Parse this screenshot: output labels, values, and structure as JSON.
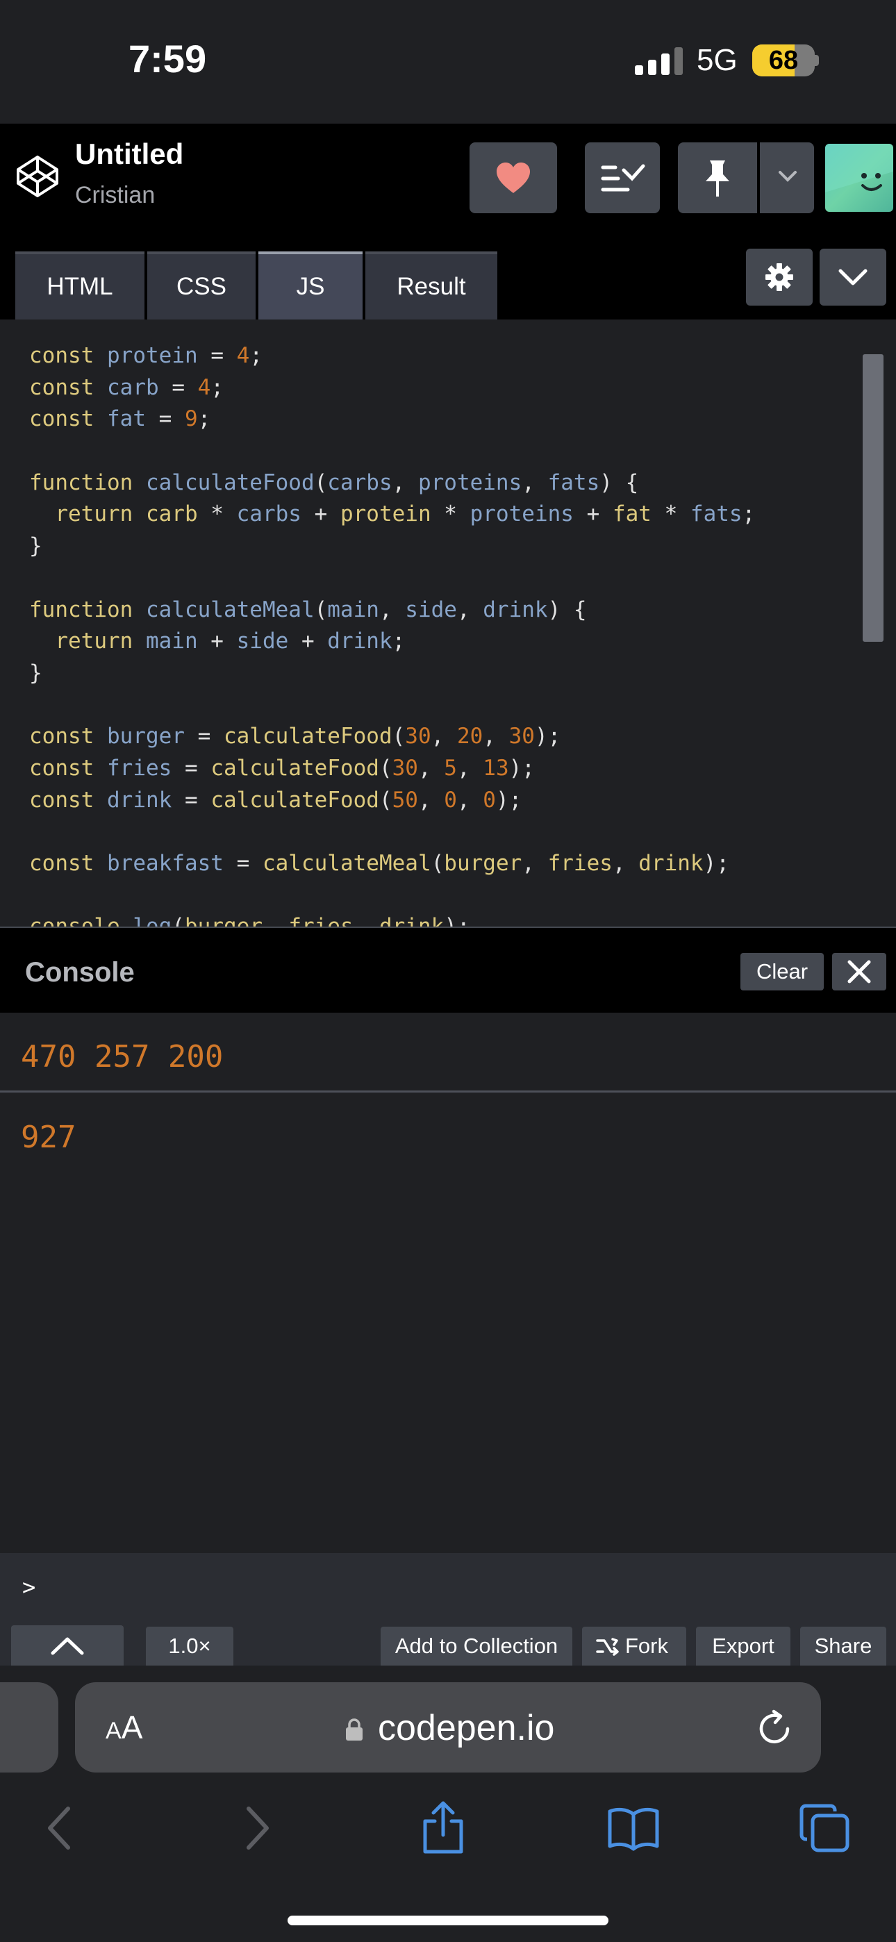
{
  "status": {
    "time": "7:59",
    "network": "5G",
    "battery": "68",
    "battery_level": 0.68
  },
  "header": {
    "title": "Untitled",
    "owner": "Cristian"
  },
  "tabs": [
    {
      "label": "HTML"
    },
    {
      "label": "CSS"
    },
    {
      "label": "JS",
      "active": true
    },
    {
      "label": "Result"
    }
  ],
  "code_lines": [
    [
      [
        "kw",
        "const"
      ],
      [
        "pu",
        " "
      ],
      [
        "vr",
        "protein"
      ],
      [
        "pu",
        " = "
      ],
      [
        "nm",
        "4"
      ],
      [
        "pu",
        ";"
      ]
    ],
    [
      [
        "kw",
        "const"
      ],
      [
        "pu",
        " "
      ],
      [
        "vr",
        "carb"
      ],
      [
        "pu",
        " = "
      ],
      [
        "nm",
        "4"
      ],
      [
        "pu",
        ";"
      ]
    ],
    [
      [
        "kw",
        "const"
      ],
      [
        "pu",
        " "
      ],
      [
        "vr",
        "fat"
      ],
      [
        "pu",
        " = "
      ],
      [
        "nm",
        "9"
      ],
      [
        "pu",
        ";"
      ]
    ],
    [],
    [
      [
        "kw",
        "function"
      ],
      [
        "pu",
        " "
      ],
      [
        "vr",
        "calculateFood"
      ],
      [
        "pu",
        "("
      ],
      [
        "vr",
        "carbs"
      ],
      [
        "pu",
        ", "
      ],
      [
        "vr",
        "proteins"
      ],
      [
        "pu",
        ", "
      ],
      [
        "vr",
        "fats"
      ],
      [
        "pu",
        ") {"
      ]
    ],
    [
      [
        "pu",
        "  "
      ],
      [
        "kw",
        "return"
      ],
      [
        "pu",
        " "
      ],
      [
        "kw",
        "carb"
      ],
      [
        "pu",
        " * "
      ],
      [
        "vr",
        "carbs"
      ],
      [
        "pu",
        " + "
      ],
      [
        "kw",
        "protein"
      ],
      [
        "pu",
        " * "
      ],
      [
        "vr",
        "proteins"
      ],
      [
        "pu",
        " + "
      ],
      [
        "kw",
        "fat"
      ],
      [
        "pu",
        " * "
      ],
      [
        "vr",
        "fats"
      ],
      [
        "pu",
        ";"
      ]
    ],
    [
      [
        "pu",
        "}"
      ]
    ],
    [],
    [
      [
        "kw",
        "function"
      ],
      [
        "pu",
        " "
      ],
      [
        "vr",
        "calculateMeal"
      ],
      [
        "pu",
        "("
      ],
      [
        "vr",
        "main"
      ],
      [
        "pu",
        ", "
      ],
      [
        "vr",
        "side"
      ],
      [
        "pu",
        ", "
      ],
      [
        "vr",
        "drink"
      ],
      [
        "pu",
        ") {"
      ]
    ],
    [
      [
        "pu",
        "  "
      ],
      [
        "kw",
        "return"
      ],
      [
        "pu",
        " "
      ],
      [
        "vr",
        "main"
      ],
      [
        "pu",
        " + "
      ],
      [
        "vr",
        "side"
      ],
      [
        "pu",
        " + "
      ],
      [
        "vr",
        "drink"
      ],
      [
        "pu",
        ";"
      ]
    ],
    [
      [
        "pu",
        "}"
      ]
    ],
    [],
    [
      [
        "kw",
        "const"
      ],
      [
        "pu",
        " "
      ],
      [
        "vr",
        "burger"
      ],
      [
        "pu",
        " = "
      ],
      [
        "fn",
        "calculateFood"
      ],
      [
        "pu",
        "("
      ],
      [
        "nm",
        "30"
      ],
      [
        "pu",
        ", "
      ],
      [
        "nm",
        "20"
      ],
      [
        "pu",
        ", "
      ],
      [
        "nm",
        "30"
      ],
      [
        "pu",
        ");"
      ]
    ],
    [
      [
        "kw",
        "const"
      ],
      [
        "pu",
        " "
      ],
      [
        "vr",
        "fries"
      ],
      [
        "pu",
        " = "
      ],
      [
        "fn",
        "calculateFood"
      ],
      [
        "pu",
        "("
      ],
      [
        "nm",
        "30"
      ],
      [
        "pu",
        ", "
      ],
      [
        "nm",
        "5"
      ],
      [
        "pu",
        ", "
      ],
      [
        "nm",
        "13"
      ],
      [
        "pu",
        ");"
      ]
    ],
    [
      [
        "kw",
        "const"
      ],
      [
        "pu",
        " "
      ],
      [
        "vr",
        "drink"
      ],
      [
        "pu",
        " = "
      ],
      [
        "fn",
        "calculateFood"
      ],
      [
        "pu",
        "("
      ],
      [
        "nm",
        "50"
      ],
      [
        "pu",
        ", "
      ],
      [
        "nm",
        "0"
      ],
      [
        "pu",
        ", "
      ],
      [
        "nm",
        "0"
      ],
      [
        "pu",
        ");"
      ]
    ],
    [],
    [
      [
        "kw",
        "const"
      ],
      [
        "pu",
        " "
      ],
      [
        "vr",
        "breakfast"
      ],
      [
        "pu",
        " = "
      ],
      [
        "fn",
        "calculateMeal"
      ],
      [
        "pu",
        "("
      ],
      [
        "kw",
        "burger"
      ],
      [
        "pu",
        ", "
      ],
      [
        "kw",
        "fries"
      ],
      [
        "pu",
        ", "
      ],
      [
        "kw",
        "drink"
      ],
      [
        "pu",
        ");"
      ]
    ],
    [],
    [
      [
        "kw",
        "console"
      ],
      [
        "pu",
        "."
      ],
      [
        "vr",
        "log"
      ],
      [
        "pu",
        "("
      ],
      [
        "kw",
        "burger"
      ],
      [
        "pu",
        ", "
      ],
      [
        "kw",
        "fries"
      ],
      [
        "pu",
        ", "
      ],
      [
        "kw",
        "drink"
      ],
      [
        "pu",
        ");"
      ]
    ]
  ],
  "console": {
    "title": "Console",
    "clear_label": "Clear",
    "outputs": [
      "470 257 200",
      "927"
    ],
    "prompt": ">"
  },
  "footer": {
    "zoom": "1.0×",
    "add_collection": "Add to Collection",
    "fork": "Fork",
    "export": "Export",
    "share": "Share"
  },
  "browser": {
    "aa_small": "A",
    "aa_big": "A",
    "url": "codepen.io"
  },
  "colors": {
    "accent_heart": "#f28b82",
    "code_keyword": "#ddca7e",
    "code_variable": "#88a4c9",
    "code_number": "#d0782a",
    "console_output": "#d0782a",
    "safari_blue": "#4a90e2"
  }
}
